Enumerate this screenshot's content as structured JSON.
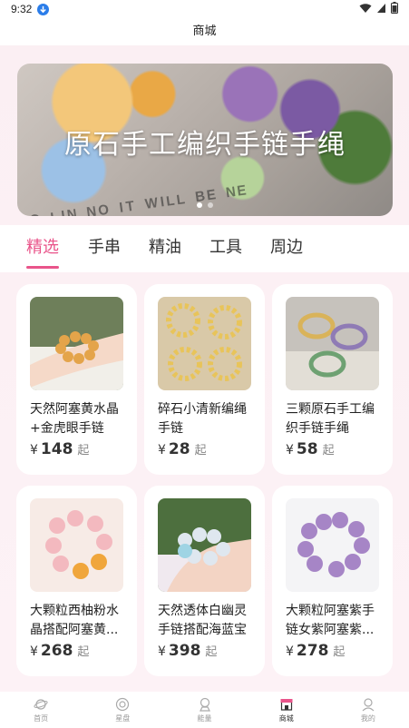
{
  "status_bar": {
    "time": "9:32"
  },
  "header": {
    "title": "商城"
  },
  "banner": {
    "title": "原石手工编织手链手绳",
    "slide_count": 2,
    "active_slide": 1
  },
  "tabs": [
    {
      "label": "精选",
      "active": true
    },
    {
      "label": "手串",
      "active": false
    },
    {
      "label": "精油",
      "active": false
    },
    {
      "label": "工具",
      "active": false
    },
    {
      "label": "周边",
      "active": false
    }
  ],
  "products": [
    {
      "name": "天然阿塞黄水晶+金虎眼手链",
      "currency": "¥",
      "price": "148",
      "unit": "起"
    },
    {
      "name": "碎石小清新编绳手链",
      "currency": "¥",
      "price": "28",
      "unit": "起"
    },
    {
      "name": "三颗原石手工编织手链手绳",
      "currency": "¥",
      "price": "58",
      "unit": "起"
    },
    {
      "name": "大颗粒西柚粉水晶搭配阿塞黄...",
      "currency": "¥",
      "price": "268",
      "unit": "起"
    },
    {
      "name": "天然透体白幽灵手链搭配海蓝宝",
      "currency": "¥",
      "price": "398",
      "unit": "起"
    },
    {
      "name": "大颗粒阿塞紫手链女紫阿塞紫...",
      "currency": "¥",
      "price": "278",
      "unit": "起"
    }
  ],
  "bottom_nav": [
    {
      "label": "首页",
      "icon": "planet-icon",
      "active": false
    },
    {
      "label": "星盘",
      "icon": "astrolabe-icon",
      "active": false
    },
    {
      "label": "能量",
      "icon": "energy-icon",
      "active": false
    },
    {
      "label": "商城",
      "icon": "shop-icon",
      "active": true
    },
    {
      "label": "我的",
      "icon": "profile-icon",
      "active": false
    }
  ],
  "colors": {
    "accent": "#e9548a",
    "page_bg": "#fbeff3",
    "card_bg": "#ffffff"
  }
}
